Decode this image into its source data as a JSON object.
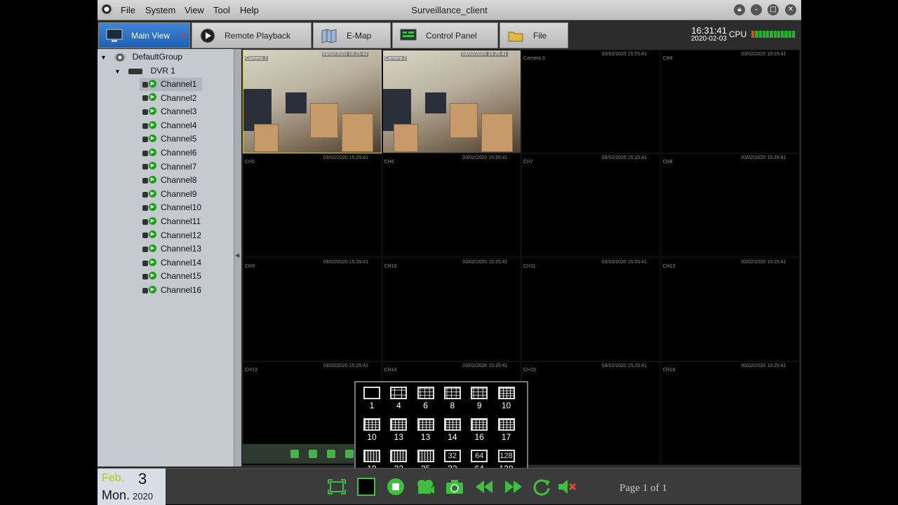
{
  "window": {
    "title": "Surveillance_client",
    "menu": [
      "File",
      "System",
      "View",
      "Tool",
      "Help"
    ]
  },
  "tabs": [
    {
      "label": "Main View",
      "icon": "monitor-icon",
      "active": true
    },
    {
      "label": "Remote Playback",
      "icon": "playback-icon"
    },
    {
      "label": "E-Map",
      "icon": "map-icon"
    },
    {
      "label": "Control Panel",
      "icon": "control-panel-icon"
    },
    {
      "label": "File",
      "icon": "folder-icon"
    }
  ],
  "status": {
    "time": "16:31:41",
    "date": "2020-02-03",
    "cpu_label": "CPU",
    "cpu_level": 0.9
  },
  "tree": {
    "group": "DefaultGroup",
    "device": "DVR 1",
    "channels": [
      "Channel1",
      "Channel2",
      "Channel3",
      "Channel4",
      "Channel5",
      "Channel6",
      "Channel7",
      "Channel8",
      "Channel9",
      "Channel10",
      "Channel11",
      "Channel12",
      "Channel13",
      "Channel14",
      "Channel15",
      "Channel16"
    ],
    "selected": "Channel1"
  },
  "grid": {
    "cells": [
      {
        "cam": "Camera 1",
        "ts": "03/02/2020 16:25:42"
      },
      {
        "cam": "Camera 2",
        "ts": "03/02/2020 16:25:41"
      },
      {
        "cam": "Camera 3",
        "ts": "03/02/2020 15:25:41"
      },
      {
        "cam": "CH4",
        "ts": "03/02/2020 15:25:41"
      },
      {
        "cam": "CH5",
        "ts": "03/02/2020 15:25:41"
      },
      {
        "cam": "CH6",
        "ts": "03/02/2020 15:25:41"
      },
      {
        "cam": "CH7",
        "ts": "03/02/2020 15:25:41"
      },
      {
        "cam": "CH8",
        "ts": "03/02/2020 15:25:41"
      },
      {
        "cam": "CH9",
        "ts": "03/02/2020 15:25:41"
      },
      {
        "cam": "CH10",
        "ts": "03/02/2020 15:25:41"
      },
      {
        "cam": "CH11",
        "ts": "03/02/2020 15:25:41"
      },
      {
        "cam": "CH12",
        "ts": "03/02/2020 15:25:41"
      },
      {
        "cam": "CH13",
        "ts": "03/02/2020 15:25:41"
      },
      {
        "cam": "CH14",
        "ts": "03/02/2020 15:25:41"
      },
      {
        "cam": "CH15",
        "ts": "03/02/2020 15:25:41"
      },
      {
        "cam": "CH16",
        "ts": "03/02/2020 15:25:41"
      }
    ]
  },
  "layouts": [
    "1",
    "4",
    "6",
    "8",
    "9",
    "10",
    "10",
    "13",
    "13",
    "14",
    "16",
    "17",
    "19",
    "22",
    "25",
    "32",
    "64",
    "128"
  ],
  "bottom": {
    "month": "Feb.",
    "day": "3",
    "weekday": "Mon.",
    "year": "2020",
    "page_info": "Page 1 of 1"
  }
}
